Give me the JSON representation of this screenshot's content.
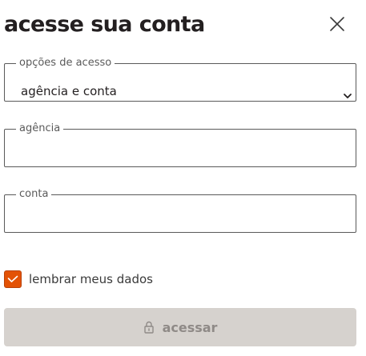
{
  "header": {
    "title": "acesse sua conta",
    "close_icon": "close-icon"
  },
  "fields": {
    "access_options": {
      "legend": "opções de acesso",
      "selected": "agência e conta",
      "icon": "chevron-down-icon"
    },
    "agency": {
      "legend": "agência",
      "value": ""
    },
    "account": {
      "legend": "conta",
      "value": ""
    }
  },
  "remember": {
    "label": "lembrar meus dados",
    "checked": true,
    "icon": "checkmark-icon"
  },
  "submit": {
    "label": "acessar",
    "icon": "lock-icon"
  },
  "colors": {
    "accent": "#e35205",
    "button_disabled_bg": "#d6d2ce",
    "button_disabled_text": "#8f8a87",
    "text": "#231f20",
    "border": "#5a5a5a"
  }
}
